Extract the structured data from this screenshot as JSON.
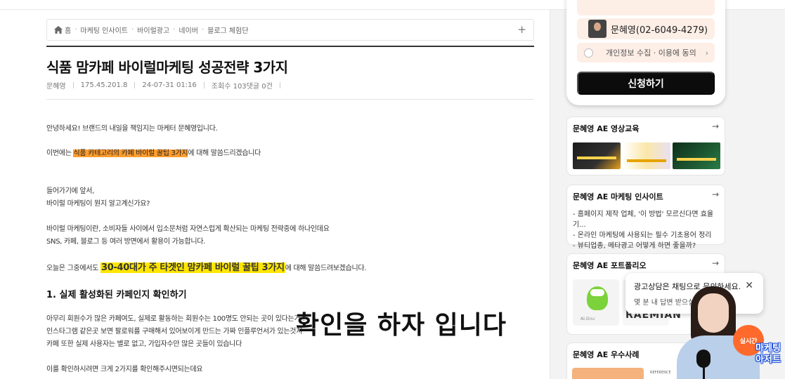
{
  "breadcrumb": {
    "items": [
      "홈",
      "마케팅 인사이트",
      "바이럴광고",
      "네이버",
      "블로그 체험단"
    ],
    "expand_label": "+"
  },
  "article": {
    "title": "식품 맘카페 바이럴마케팅 성공전략 3가지",
    "author": "문혜영",
    "ip": "175.45.201.8",
    "datetime": "24-07-31 01:16",
    "stats": "조회수 103댓글 0건",
    "p1": "안녕하세요! 브랜드의 내일을 책임지는 마케터 문혜영입니다.",
    "p2_pre": "이번에는 ",
    "p2_hl": "식품 카테고리의 카페 바이럴 꿀팁 3가지",
    "p2_post": "에 대해 말씀드리겠습니다",
    "p3a": "들어가기에 앞서,",
    "p3b": "바이럴 마케팅이 뭔지 알고계신가요?",
    "p4a": "바이럴 마케팅이란, 소비자들 사이에서 입소문처럼 자연스럽게 확산되는 마케팅 전략중에 하나인데요",
    "p4b": " SNS, 카페, 블로그 등 여러 방면에서 활용이 가능합니다.",
    "p5_pre": "오늘은 그중에서도 ",
    "p5_hl": "30-40대가 주 타겟인 맘카페 바이럴 꿀팁 3가지",
    "p5_post": "에 대해 말씀드려보겠습니다.",
    "h2": "1. 실제 활성화된 카페인지 확인하기",
    "p6a": "아무리 회원수가 많은 카페여도, 실제로 활동하는 회원수는 100명도 안되는 곳이 있다는거 !",
    "p6b": "인스타그램 같은곳 보면 팔로워를 구매해서 있어보이게 만드는 가짜 인플루언서가 있는것처",
    "p6c": "카페 또한 실제 사용자는 별로 없고, 가입자수만 많은 곳들이 있습니다",
    "p7": "이를 확인하시려면 크게 2가지를 확인해주시면되는데요"
  },
  "subtitle_overlay": "확인을 하자 입니다",
  "form": {
    "phone": "문혜영(02-6049-4279)",
    "privacy": "개인정보 수집 · 이용에 동의",
    "apply": "신청하기"
  },
  "cards": {
    "video": {
      "title": "문혜영 AE 영상교육",
      "arrow": "→"
    },
    "insight": {
      "title": "문혜영 AE 마케팅 인사이트",
      "arrow": "→",
      "items": [
        "- 홈페이지 제작 업체, '이 방법' 모르신다면 효율 기...",
        "- 온라인 마케팅에 사용되는 필수 기초용어 정리",
        "- 뷰티업종, 메타광고 어떻게 하면 좋을까?"
      ]
    },
    "portfolio": {
      "title": "문혜영 AE 포트폴리오",
      "arrow": "→",
      "brand_text": "RAEMIAN",
      "small_text": "AI.Gnu"
    },
    "cases": {
      "title": "문혜영 AE 우수사례",
      "ref_text": "REFERENCE"
    }
  },
  "chat": {
    "line1": "광고상담은 채팅으로 문의하세요.",
    "line2": "몇 분 내 답변 받으실",
    "close": "✕"
  },
  "live_badge": "실시간",
  "brand_logo": "마케팅아저트",
  "colors": {
    "highlight_orange": "#ff9d2e",
    "highlight_yellow": "#ffe600",
    "button_black": "#0c0c0c",
    "form_bg": "#fdeee6",
    "live_orange": "#ff6a2c"
  }
}
